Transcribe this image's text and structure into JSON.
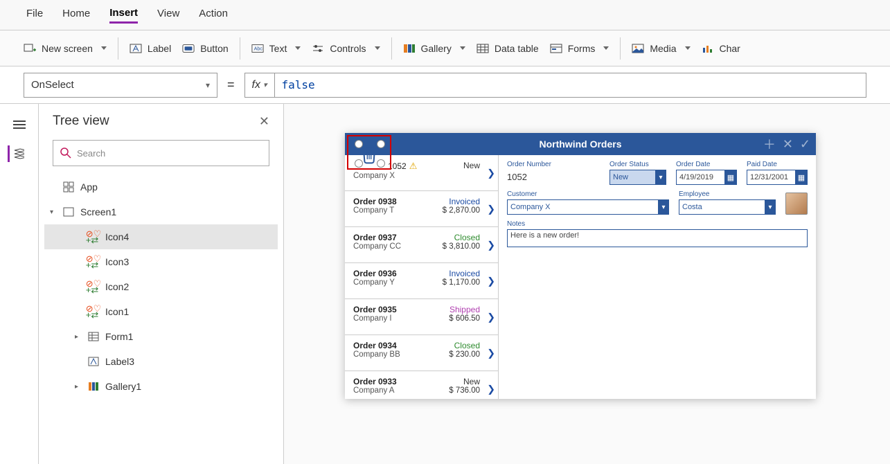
{
  "menu": {
    "items": [
      "File",
      "Home",
      "Insert",
      "View",
      "Action"
    ],
    "activeIndex": 2
  },
  "ribbon": {
    "newScreen": "New screen",
    "label": "Label",
    "button": "Button",
    "text": "Text",
    "controls": "Controls",
    "gallery": "Gallery",
    "dataTable": "Data table",
    "forms": "Forms",
    "media": "Media",
    "charts": "Char"
  },
  "formula": {
    "property": "OnSelect",
    "fx": "fx",
    "value": "false"
  },
  "treeview": {
    "title": "Tree view",
    "searchPlaceholder": "Search",
    "app": "App",
    "screen": "Screen1",
    "nodes": [
      {
        "label": "Icon4",
        "type": "icon",
        "selected": true
      },
      {
        "label": "Icon3",
        "type": "icon"
      },
      {
        "label": "Icon2",
        "type": "icon"
      },
      {
        "label": "Icon1",
        "type": "icon"
      },
      {
        "label": "Form1",
        "type": "form",
        "expandable": true
      },
      {
        "label": "Label3",
        "type": "label"
      },
      {
        "label": "Gallery1",
        "type": "gallery",
        "expandable": true
      }
    ]
  },
  "app": {
    "title": "Northwind Orders",
    "orders": [
      {
        "orderNo": "1052",
        "company": "Company X",
        "status": "New",
        "price": "",
        "warn": true,
        "firstRaw": true
      },
      {
        "orderNo": "Order 0938",
        "company": "Company T",
        "status": "Invoiced",
        "price": "$ 2,870.00"
      },
      {
        "orderNo": "Order 0937",
        "company": "Company CC",
        "status": "Closed",
        "price": "$ 3,810.00"
      },
      {
        "orderNo": "Order 0936",
        "company": "Company Y",
        "status": "Invoiced",
        "price": "$ 1,170.00"
      },
      {
        "orderNo": "Order 0935",
        "company": "Company I",
        "status": "Shipped",
        "price": "$ 606.50"
      },
      {
        "orderNo": "Order 0934",
        "company": "Company BB",
        "status": "Closed",
        "price": "$ 230.00"
      },
      {
        "orderNo": "Order 0933",
        "company": "Company A",
        "status": "New",
        "price": "$ 736.00"
      }
    ],
    "detail": {
      "labels": {
        "orderNumber": "Order Number",
        "orderStatus": "Order Status",
        "orderDate": "Order Date",
        "paidDate": "Paid Date",
        "customer": "Customer",
        "employee": "Employee",
        "notes": "Notes"
      },
      "orderNumber": "1052",
      "orderStatus": "New",
      "orderDate": "4/19/2019",
      "paidDate": "12/31/2001",
      "customer": "Company X",
      "employee": "Costa",
      "notes": "Here is a new order!"
    }
  }
}
